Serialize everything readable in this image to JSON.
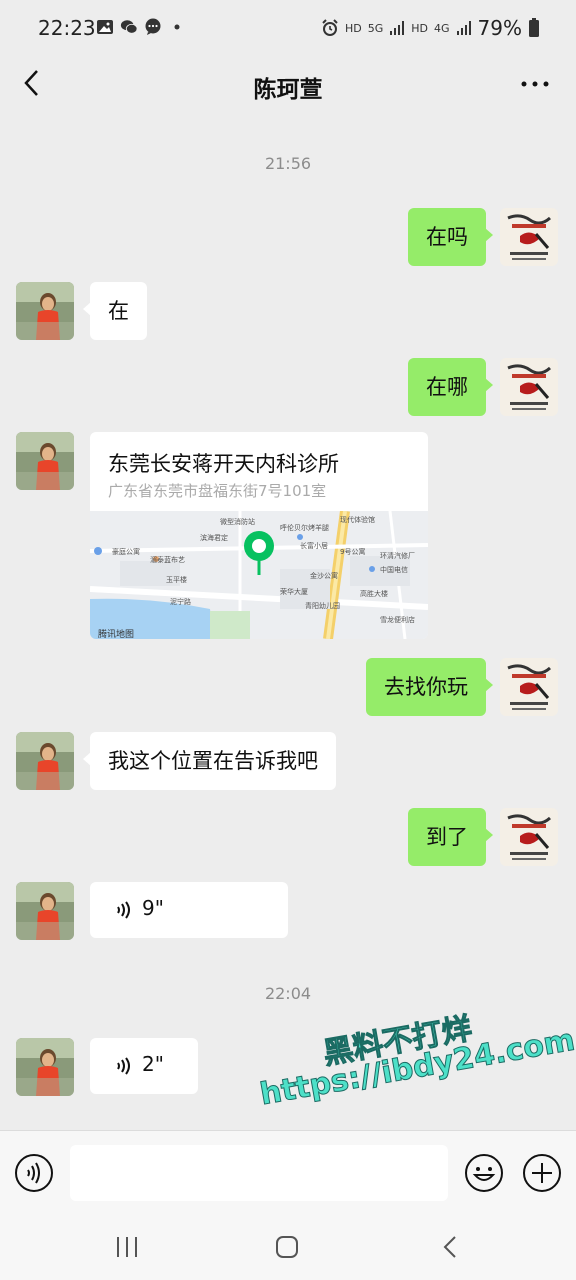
{
  "status_bar": {
    "time": "22:23",
    "hd1": "HD",
    "net1": "5G",
    "hd2": "HD",
    "net2": "4G",
    "battery": "79%"
  },
  "header": {
    "title": "陈珂萱"
  },
  "chat": {
    "time1": "21:56",
    "time2": "22:04",
    "messages": [
      {
        "from": "me",
        "text": "在吗"
      },
      {
        "from": "other",
        "text": "在"
      },
      {
        "from": "me",
        "text": "在哪"
      },
      {
        "from": "other",
        "type": "location",
        "title": "东莞长安蒋开天内科诊所",
        "address": "广东省东莞市盘福东街7号101室"
      },
      {
        "from": "me",
        "text": "去找你玩"
      },
      {
        "from": "other",
        "text": "我这个位置在告诉我吧"
      },
      {
        "from": "me",
        "text": "到了"
      },
      {
        "from": "other",
        "type": "voice",
        "duration": "9\""
      },
      {
        "from": "other",
        "type": "voice",
        "duration": "2\""
      }
    ]
  },
  "map": {
    "provider": "腾讯地图",
    "labels": [
      "微型消防站",
      "呼伦贝尔烤羊腿",
      "现代体验馆",
      "天",
      "滨海君定",
      "滨海颐景公寓",
      "豪庭公寓",
      "碧海星宿",
      "湄泰蓝布艺",
      "港前新开",
      "长富小居",
      "9号公寓",
      "环清汽修厂",
      "叮当幼儿园",
      "中国电信",
      "玉平楼",
      "金沙公寓",
      "格电",
      "荣华大厦",
      "永新楼",
      "高胜大楼",
      "潘安花园",
      "青阳幼儿园",
      "雪龙便利店",
      "乔柏",
      "泥宁路",
      "长城路"
    ]
  },
  "watermark": {
    "line1": "黑料不打烊",
    "line2": "https://ibdy24.com"
  },
  "icons": {
    "back": "chevron-left-icon",
    "more": "more-dots-icon",
    "voice_mode": "voice-mode-icon",
    "emoji": "emoji-icon",
    "plus": "plus-icon"
  },
  "colors": {
    "outgoing_bubble": "#95ec69",
    "incoming_bubble": "#ffffff",
    "background": "#ededed",
    "watermark": "#4de0c8"
  }
}
